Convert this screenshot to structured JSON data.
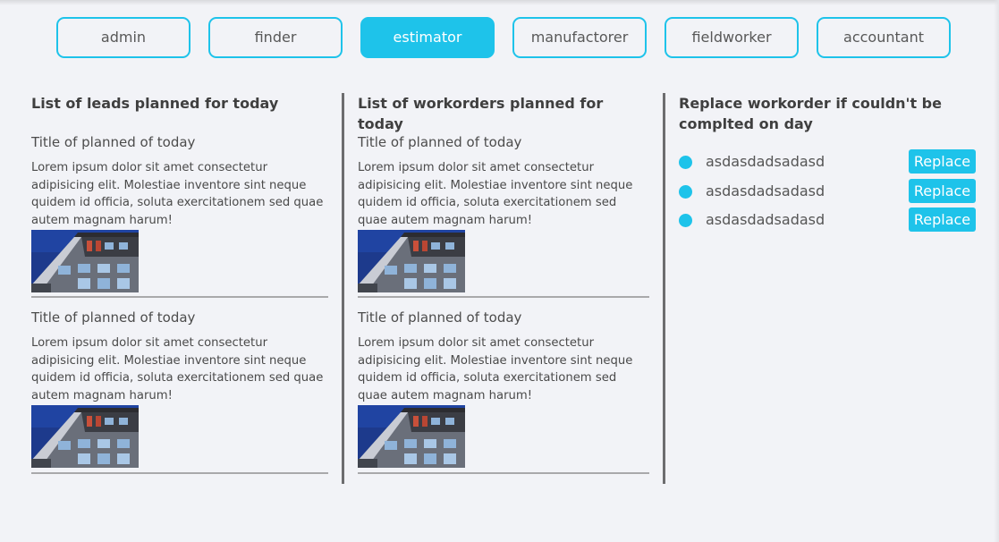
{
  "roles": [
    {
      "label": "admin",
      "active": false
    },
    {
      "label": "finder",
      "active": false
    },
    {
      "label": "estimator",
      "active": true
    },
    {
      "label": "manufactorer",
      "active": false
    },
    {
      "label": "fieldworker",
      "active": false
    },
    {
      "label": "accountant",
      "active": false
    }
  ],
  "leads": {
    "title": "List of leads planned for today",
    "items": [
      {
        "title": "Title of planned of today",
        "body": "Lorem ipsum dolor sit amet consectetur adipisicing elit. Molestiae inventore sint neque quidem id officia, soluta exercitationem sed quae autem magnam harum!"
      },
      {
        "title": "Title of planned of today",
        "body": "Lorem ipsum dolor sit amet consectetur adipisicing elit. Molestiae inventore sint neque quidem id officia, soluta exercitationem sed quae autem magnam harum!"
      }
    ]
  },
  "workorders": {
    "title": "List of workorders planned for today",
    "items": [
      {
        "title": "Title of planned of today",
        "body": "Lorem ipsum dolor sit amet consectetur adipisicing elit. Molestiae inventore sint neque quidem id officia, soluta exercitationem sed quae autem magnam harum!"
      },
      {
        "title": "Title of planned of today",
        "body": "Lorem ipsum dolor sit amet consectetur adipisicing elit. Molestiae inventore sint neque quidem id officia, soluta exercitationem sed quae autem magnam harum!"
      }
    ]
  },
  "replace": {
    "title": "Replace workorder if couldn't be complted on day",
    "button_label": "Replace",
    "items": [
      {
        "text": "asdasdadsadasd"
      },
      {
        "text": "asdasdadsadasd"
      },
      {
        "text": "asdasdadsadasd"
      }
    ]
  },
  "colors": {
    "accent": "#1ec3ea",
    "background": "#f2f3f7",
    "divider": "#a9a9ab",
    "column_rule": "#6d6d6f"
  },
  "icons": {
    "list_bullet": "filled-circle",
    "card_image": "building-photo"
  }
}
